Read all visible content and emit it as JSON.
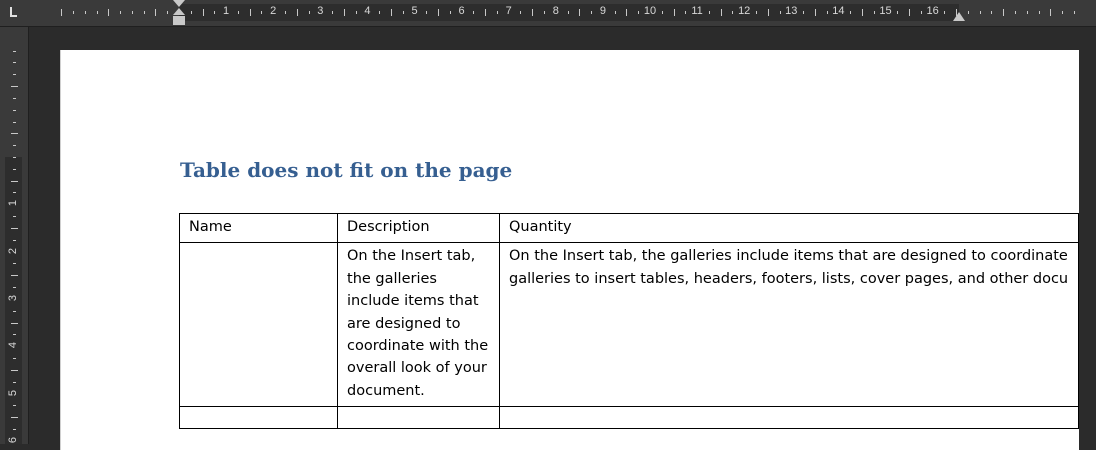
{
  "ruler": {
    "horizontal_numbers": [
      "1",
      "2",
      "3",
      "4",
      "5",
      "6",
      "7",
      "8",
      "9",
      "10",
      "11",
      "12",
      "13",
      "14",
      "15",
      "16"
    ],
    "vertical_numbers": [
      "1",
      "2",
      "3",
      "4",
      "5",
      "6"
    ]
  },
  "document": {
    "heading": "Table does not fit on the page",
    "table": {
      "headers": [
        "Name",
        "Description",
        "Quantity"
      ],
      "rows": [
        {
          "name": "",
          "description": "On the Insert tab, the galleries include items that are designed to coordinate with the overall look of your document.",
          "quantity_line1": "On the Insert tab, the galleries include items that are designed to coordinate with the overall look of your document. You can use these",
          "quantity_line2": "galleries to insert tables, headers, footers, lists, cover pages, and other document building blocks."
        },
        {
          "name": "",
          "description": "",
          "quantity": ""
        }
      ]
    }
  },
  "colors": {
    "heading": "#365f91",
    "ruler_bg": "#3a3a3a",
    "workspace_bg": "#2b2b2b"
  }
}
